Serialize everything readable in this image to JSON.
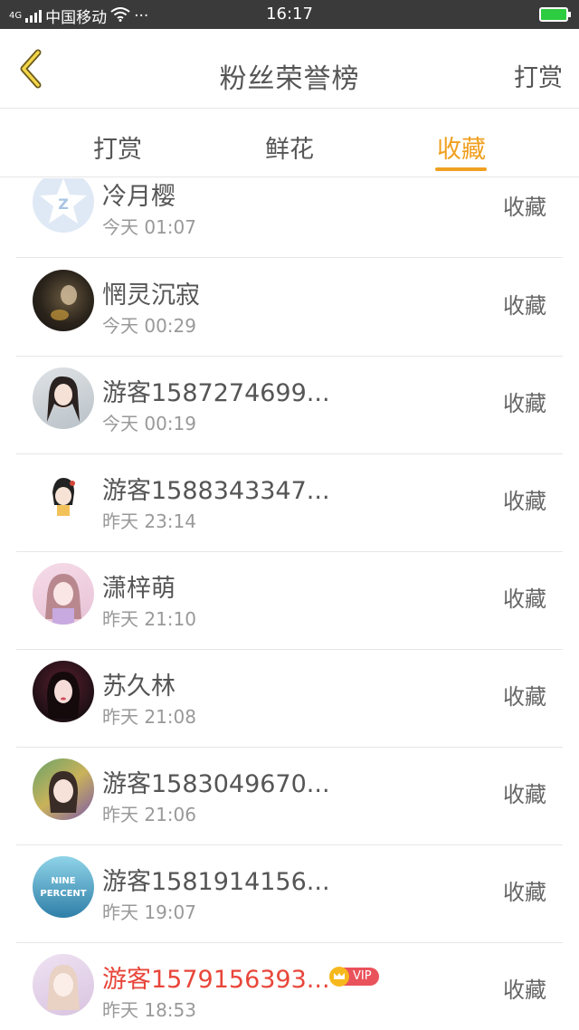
{
  "status_bar": {
    "network": "4G",
    "carrier": "中国移动",
    "extra": "···",
    "time": "16:17"
  },
  "navbar": {
    "title": "粉丝荣誉榜",
    "action": "打赏"
  },
  "tabs": [
    {
      "label": "打赏",
      "active": false
    },
    {
      "label": "鲜花",
      "active": false
    },
    {
      "label": "收藏",
      "active": true
    }
  ],
  "colors": {
    "accent": "#f0a020",
    "vip_name": "#e8463a",
    "vip_badge": "#e9525a"
  },
  "list": [
    {
      "name": "冷月樱",
      "time": "今天 01:07",
      "action": "收藏",
      "vip": false
    },
    {
      "name": "惘灵沉寂",
      "time": "今天 00:29",
      "action": "收藏",
      "vip": false
    },
    {
      "name": "游客1587274699...",
      "time": "今天 00:19",
      "action": "收藏",
      "vip": false
    },
    {
      "name": "游客1588343347...",
      "time": "昨天 23:14",
      "action": "收藏",
      "vip": false
    },
    {
      "name": "潇梓萌",
      "time": "昨天 21:10",
      "action": "收藏",
      "vip": false
    },
    {
      "name": "苏久林",
      "time": "昨天 21:08",
      "action": "收藏",
      "vip": false
    },
    {
      "name": "游客1583049670...",
      "time": "昨天 21:06",
      "action": "收藏",
      "vip": false
    },
    {
      "name": "游客1581914156...",
      "time": "昨天 19:07",
      "action": "收藏",
      "vip": false
    },
    {
      "name": "游客1579156393...",
      "time": "昨天 18:53",
      "action": "收藏",
      "vip": true,
      "badge": "VIP"
    }
  ]
}
